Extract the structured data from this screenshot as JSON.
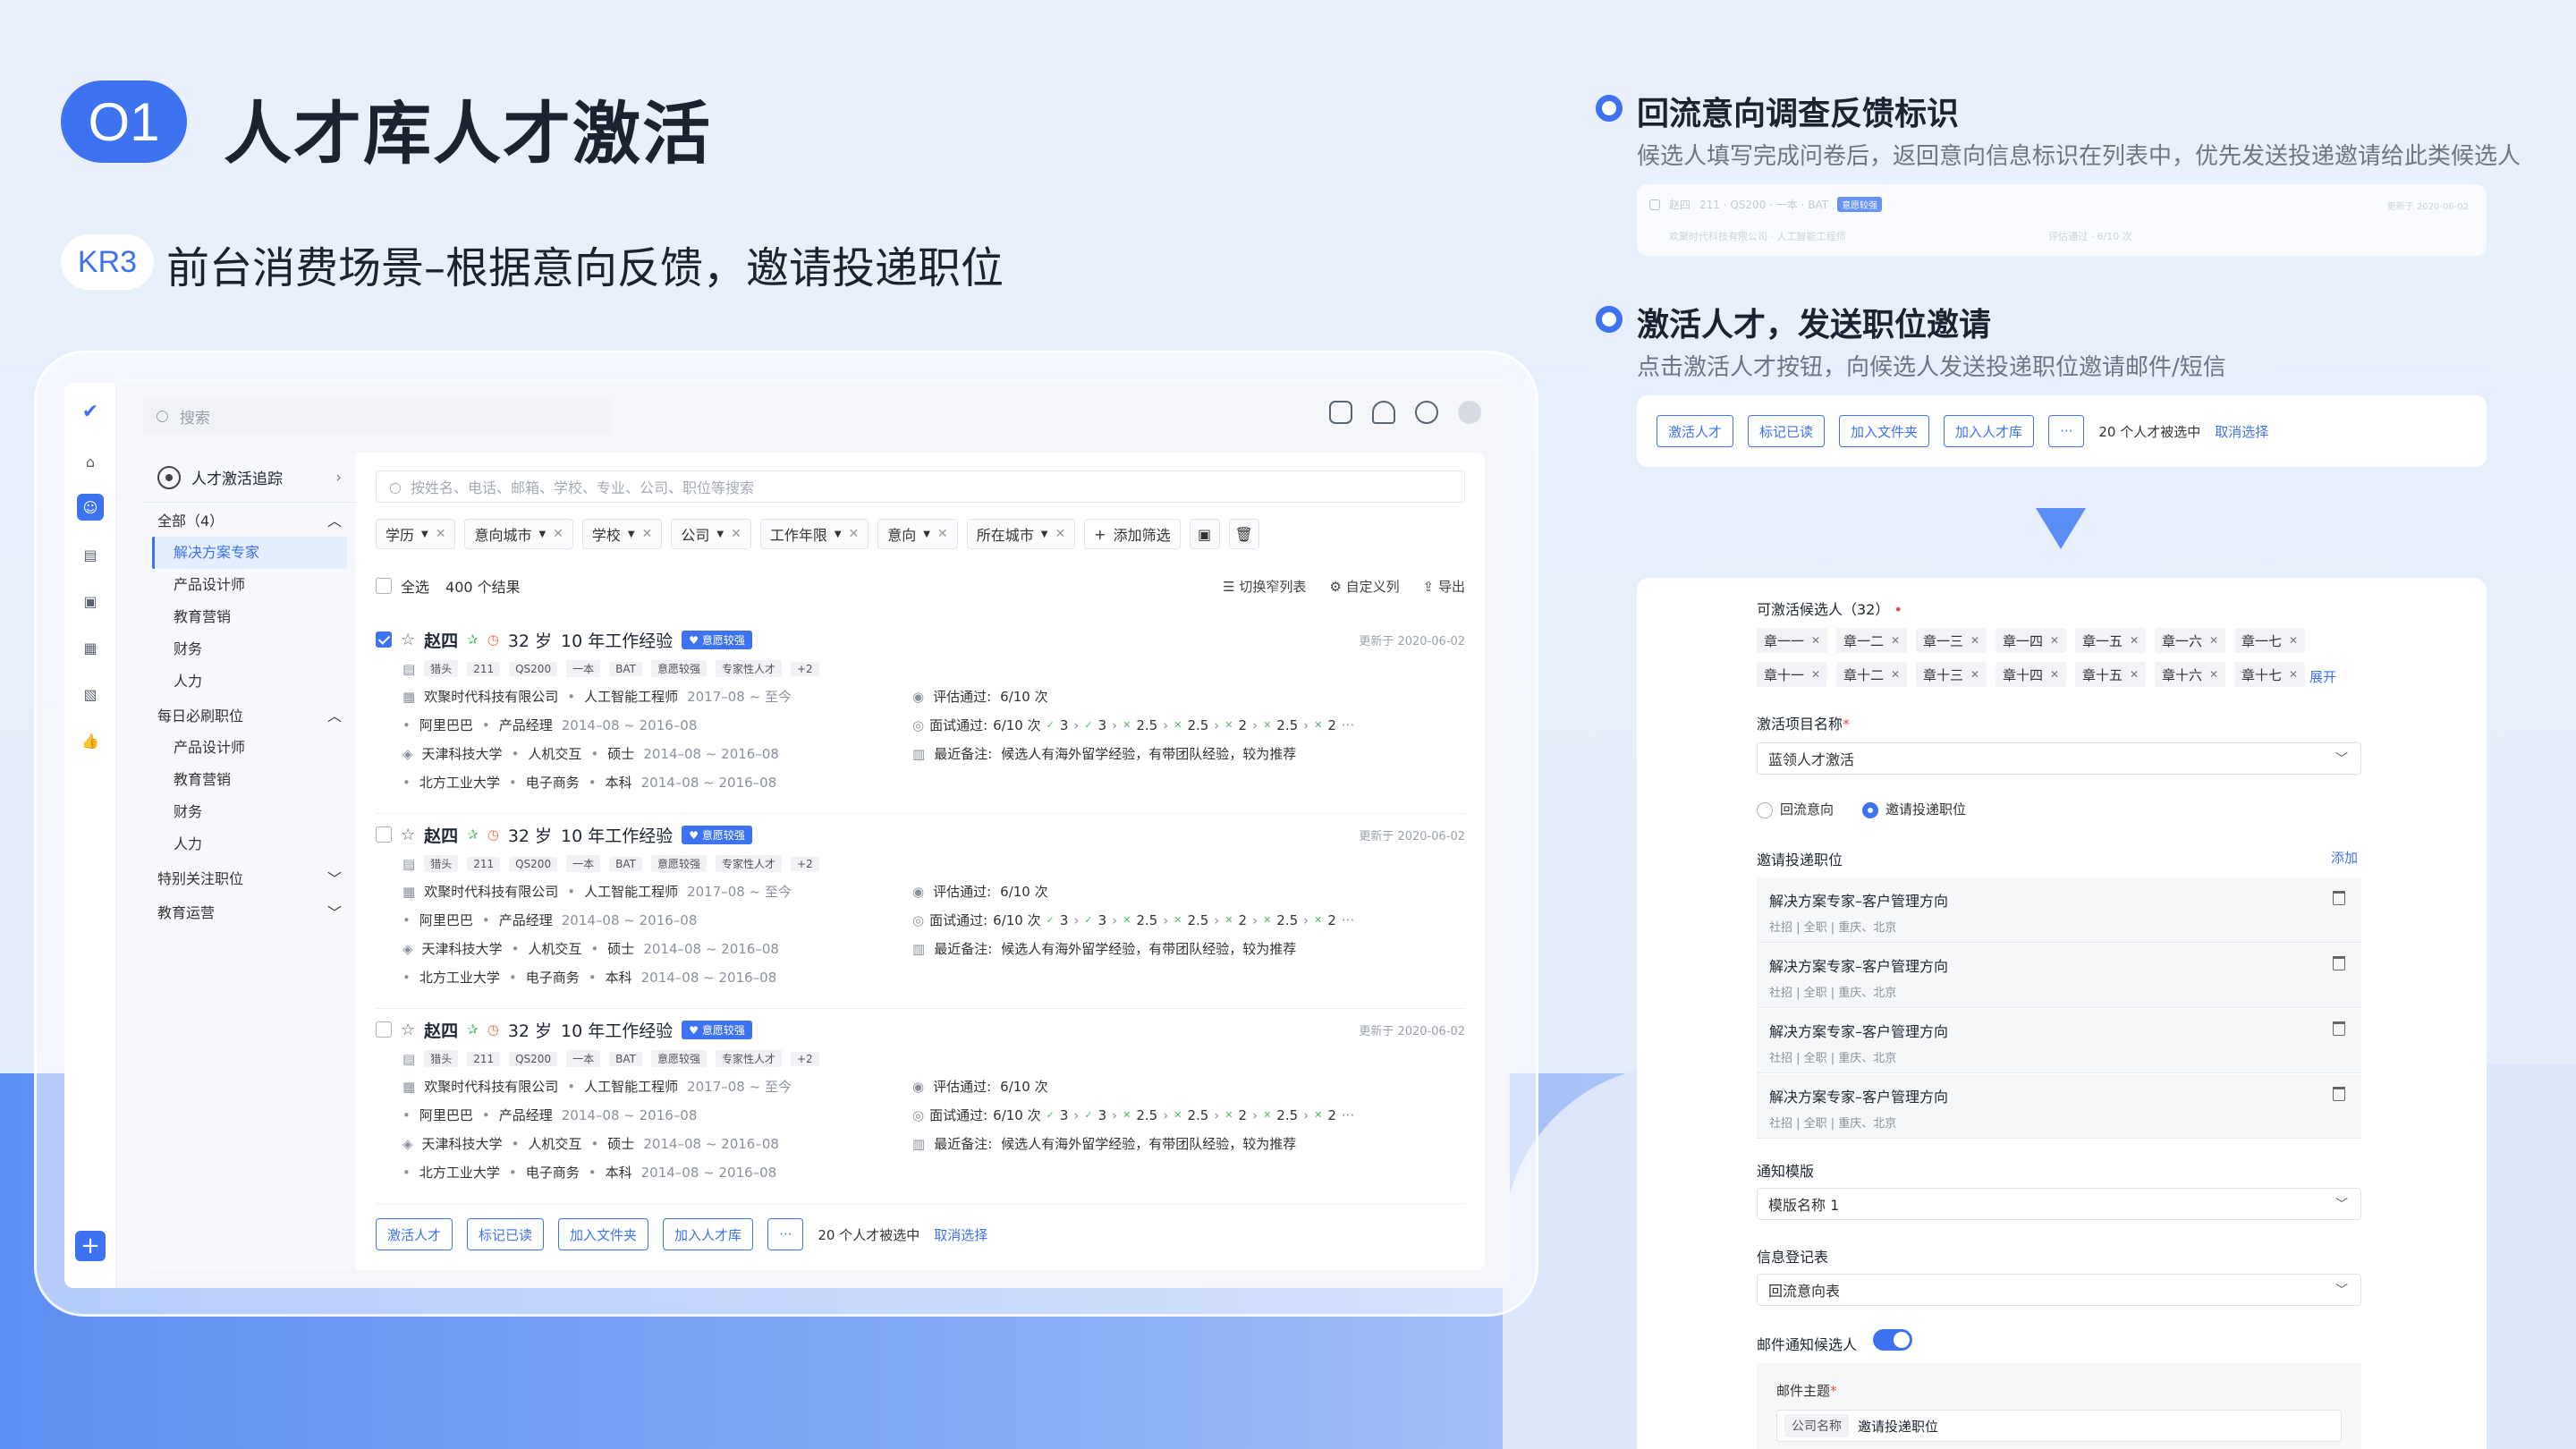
{
  "header": {
    "badge": "O1",
    "title": "人才库人才激活",
    "kr_badge": "KR3",
    "subtitle": "前台消费场景–根据意向反馈，邀请投递职位"
  },
  "colors": {
    "accent": "#3d72f0",
    "text": "#1b2230"
  },
  "app": {
    "search_placeholder": "搜索",
    "sidebar": {
      "title": "人才激活追踪",
      "groups": [
        {
          "label": "全部（4）",
          "items": [
            "解决方案专家",
            "产品设计师",
            "教育营销",
            "财务",
            "人力"
          ]
        },
        {
          "label": "每日必刷职位",
          "items": [
            "产品设计师",
            "教育营销",
            "财务",
            "人力"
          ]
        },
        {
          "label": "特别关注职位",
          "items": []
        },
        {
          "label": "教育运营",
          "items": []
        }
      ]
    },
    "filter_placeholder": "按姓名、电话、邮箱、学校、专业、公司、职位等搜索",
    "filters": [
      "学历",
      "意向城市",
      "学校",
      "公司",
      "工作年限",
      "意向",
      "所在城市"
    ],
    "add_filter": "添加筛选",
    "select_all": "全选",
    "result_count": "400 个结果",
    "tools": [
      "切换窄列表",
      "自定义列",
      "导出"
    ],
    "candidate": {
      "name": "赵四",
      "age": "32 岁",
      "exp": "10 年工作经验",
      "intent_tag": "意愿较强",
      "updated": "更新于 2020-06-02",
      "tags": [
        "猎头",
        "211",
        "QS200",
        "一本",
        "BAT",
        "意愿较强",
        "专家性人才",
        "+2"
      ],
      "work1": {
        "company": "欢聚时代科技有限公司",
        "title": "人工智能工程师",
        "period": "2017–08 ~ 至今"
      },
      "work2": {
        "company": "阿里巴巴",
        "title": "产品经理",
        "period": "2014–08 ~ 2016–08"
      },
      "edu1": {
        "school": "天津科技大学",
        "major": "人机交互",
        "degree": "硕士",
        "period": "2014–08 ~ 2016–08"
      },
      "edu2": {
        "school": "北方工业大学",
        "major": "电子商务",
        "degree": "本科",
        "period": "2014–08 ~ 2016–08"
      },
      "eval_label": "评估通过:",
      "eval_val": "6/10 次",
      "interview_label": "面试通过:",
      "interview_val": "6/10 次",
      "scores": [
        "3",
        "3",
        "2.5",
        "2.5",
        "2",
        "2.5",
        "2"
      ],
      "note_label": "最近备注:",
      "note": "候选人有海外留学经验，有带团队经验，较为推荐"
    },
    "bottom": {
      "buttons": [
        "激活人才",
        "标记已读",
        "加入文件夹",
        "加入人才库"
      ],
      "more": "···",
      "selected": "20 个人才被选中",
      "cancel": "取消选择"
    }
  },
  "right": {
    "feature1": {
      "title": "回流意向调查反馈标识",
      "desc": "候选人填写完成问卷后，返回意向信息标识在列表中，优先发送投递邀请给此类候选人",
      "preview": {
        "name": "赵四",
        "line": "211 · QS200 · 一本 · BAT",
        "tag": "意愿较强",
        "company": "欢聚时代科技有限公司 · 人工智能工程师",
        "eval": "评估通过 · 6/10 次",
        "updated": "更新于 2020-06-02"
      }
    },
    "feature2": {
      "title": "激活人才，发送职位邀请",
      "desc": "点击激活人才按钮，向候选人发送投递职位邀请邮件/短信"
    },
    "form": {
      "candidates_label": "可激活候选人（32）",
      "people": [
        "章一一",
        "章一二",
        "章一三",
        "章一四",
        "章一五",
        "章一六",
        "章一七",
        "章十一",
        "章十二",
        "章十三",
        "章十四",
        "章十五",
        "章十六",
        "章十七"
      ],
      "expand": "展开",
      "project_label": "激活项目名称",
      "project_value": "蓝领人才激活",
      "radio_options": [
        "回流意向",
        "邀请投递职位"
      ],
      "jobs_label": "邀请投递职位",
      "add": "添加",
      "jobs": [
        {
          "title": "解决方案专家–客户管理方向",
          "meta": "社招  |  全职  |  重庆、北京"
        },
        {
          "title": "解决方案专家–客户管理方向",
          "meta": "社招  |  全职  |  重庆、北京"
        },
        {
          "title": "解决方案专家–客户管理方向",
          "meta": "社招  |  全职  |  重庆、北京"
        },
        {
          "title": "解决方案专家–客户管理方向",
          "meta": "社招  |  全职  |  重庆、北京"
        }
      ],
      "template_label": "通知模版",
      "template_value": "模版名称 1",
      "register_label": "信息登记表",
      "register_value": "回流意向表",
      "email_label": "邮件通知候选人",
      "subject_label": "邮件主题",
      "subject_tag": "公司名称",
      "subject_value": "邀请投递职位"
    }
  }
}
